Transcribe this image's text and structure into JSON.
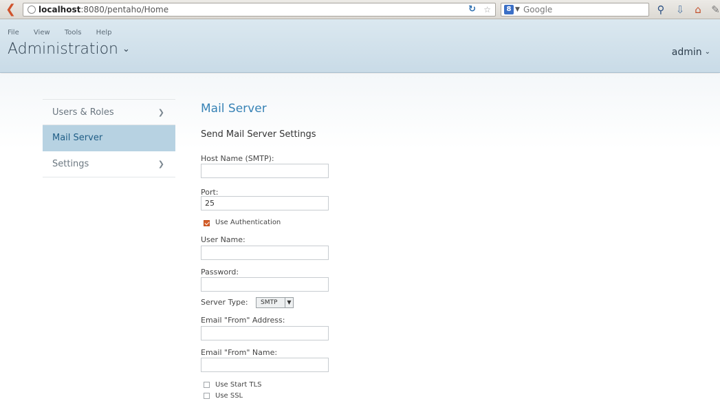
{
  "browser": {
    "url_host": "localhost",
    "url_rest": ":8080/pentaho/Home",
    "search_placeholder": "Google",
    "search_engine_badge": "8"
  },
  "menu": [
    "File",
    "View",
    "Tools",
    "Help"
  ],
  "header": {
    "title": "Administration",
    "user": "admin"
  },
  "sidebar": {
    "items": [
      {
        "label": "Users & Roles",
        "has_arrow": true,
        "active": false
      },
      {
        "label": "Mail Server",
        "has_arrow": false,
        "active": true
      },
      {
        "label": "Settings",
        "has_arrow": true,
        "active": false
      }
    ]
  },
  "main": {
    "page_title": "Mail Server",
    "section_title": "Send Mail Server Settings",
    "host_label": "Host Name (SMTP):",
    "host_value": "",
    "port_label": "Port:",
    "port_value": "25",
    "use_auth_label": "Use Authentication",
    "use_auth_checked": true,
    "username_label": "User Name:",
    "username_value": "",
    "password_label": "Password:",
    "password_value": "",
    "server_type_label": "Server Type:",
    "server_type_value": "SMTP",
    "from_address_label": "Email \"From\" Address:",
    "from_address_value": "",
    "from_name_label": "Email \"From\" Name:",
    "from_name_value": "",
    "start_tls_label": "Use Start TLS",
    "start_tls_checked": false,
    "ssl_label": "Use SSL",
    "ssl_checked": false
  },
  "colors": {
    "accent": "#3682b5",
    "active_nav_bg": "#b7d2e2",
    "checkbox_checked": "#d55f2b",
    "header_bg": "#c9dbe7"
  }
}
